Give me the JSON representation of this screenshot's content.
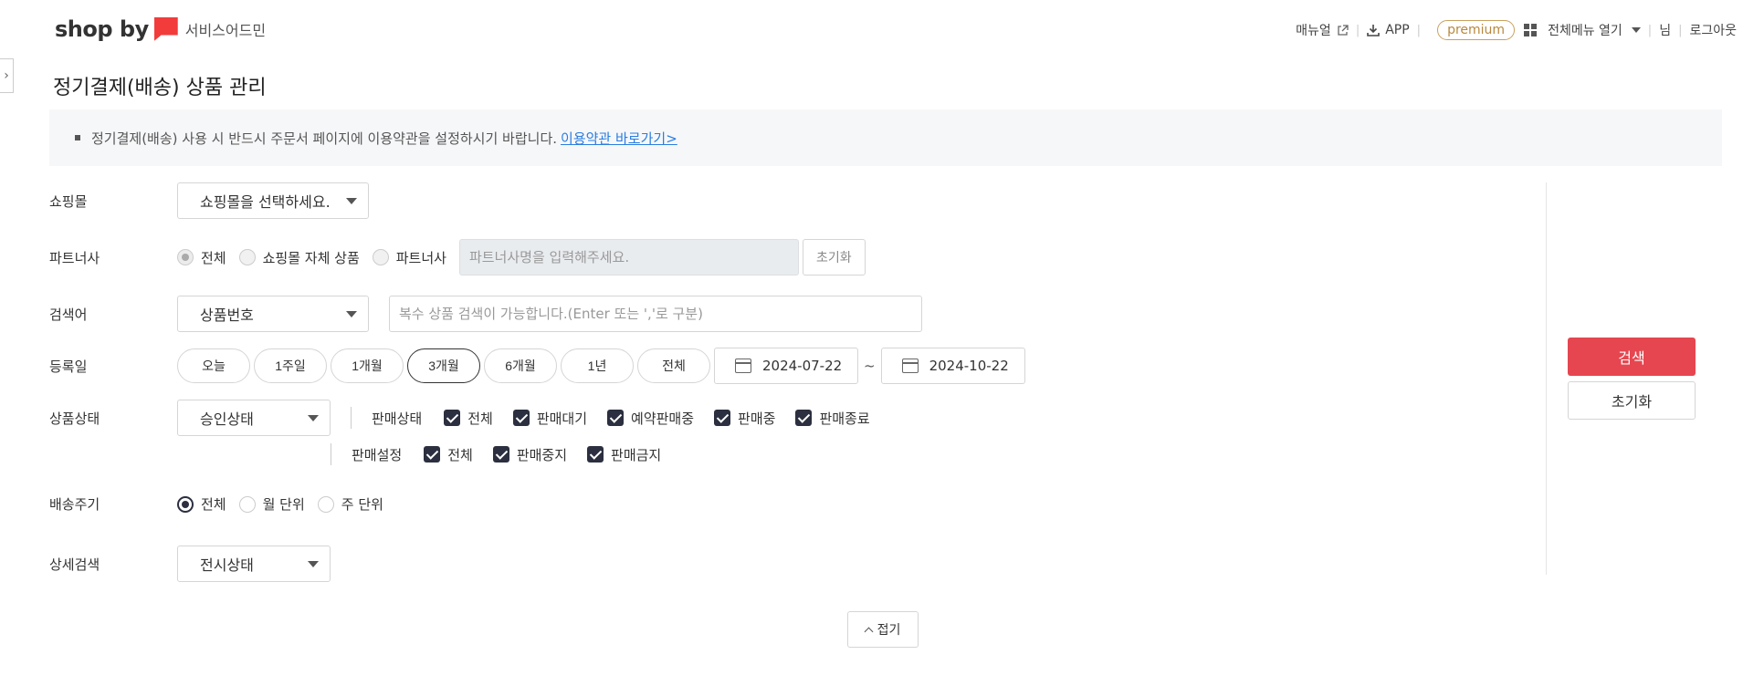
{
  "header": {
    "logo_text": "shop by",
    "logo_sub": "서비스어드민",
    "nav": {
      "manual": "매뉴얼",
      "app": "APP",
      "premium": "premium",
      "all_menu": "전체메뉴 열기",
      "user_suffix": "님",
      "logout": "로그아웃"
    }
  },
  "page_title": "정기결제(배송) 상품 관리",
  "notice": {
    "text": "정기결제(배송) 사용 시 반드시 주문서 페이지에 이용약관을 설정하시기 바랍니다.",
    "link": "이용약관 바로가기>"
  },
  "form": {
    "mall": {
      "label": "쇼핑몰",
      "value": "쇼핑몰을 선택하세요."
    },
    "partner": {
      "label": "파트너사",
      "options": [
        "전체",
        "쇼핑몰 자체 상품",
        "파트너사"
      ],
      "input_placeholder": "파트너사명을 입력해주세요.",
      "reset": "초기화"
    },
    "keyword": {
      "label": "검색어",
      "select_value": "상품번호",
      "input_placeholder": "복수 상품 검색이 가능합니다.(Enter 또는 ','로 구분)"
    },
    "reg_date": {
      "label": "등록일",
      "periods": [
        "오늘",
        "1주일",
        "1개월",
        "3개월",
        "6개월",
        "1년",
        "전체"
      ],
      "active_period": "3개월",
      "start": "2024-07-22",
      "tilde": "~",
      "end": "2024-10-22"
    },
    "status": {
      "label": "상품상태",
      "approval_value": "승인상태",
      "sale_status_label": "판매상태",
      "sale_status_options": [
        "전체",
        "판매대기",
        "예약판매중",
        "판매중",
        "판매종료"
      ],
      "sale_setting_label": "판매설정",
      "sale_setting_options": [
        "전체",
        "판매중지",
        "판매금지"
      ]
    },
    "delivery_cycle": {
      "label": "배송주기",
      "options": [
        "전체",
        "월 단위",
        "주 단위"
      ],
      "selected": "전체"
    },
    "detail": {
      "label": "상세검색",
      "value": "전시상태"
    }
  },
  "actions": {
    "search": "검색",
    "reset": "초기화",
    "fold": "접기"
  }
}
